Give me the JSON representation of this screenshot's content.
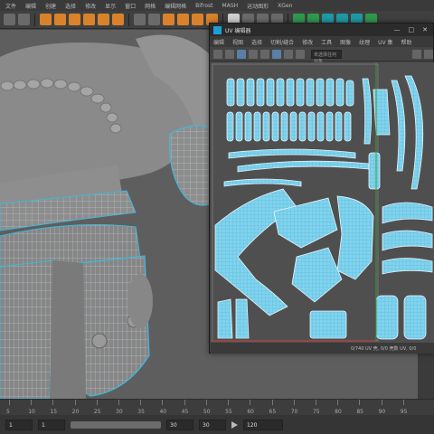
{
  "menu": [
    "文件",
    "编辑",
    "创建",
    "选择",
    "修改",
    "显示",
    "窗口",
    "网格",
    "编辑网格",
    "Bifrost",
    "MASH",
    "运动图形",
    "XGen"
  ],
  "uv_editor": {
    "title": "UV 编辑器",
    "menus": [
      "编辑",
      "视图",
      "选择",
      "切割/缝合",
      "修改",
      "工具",
      "图像",
      "纹理",
      "UV 集",
      "帮助"
    ],
    "toolbar_field_placeholder": "未选择任何对象",
    "status_text": "0/740 UV 壳, 0/0 壳数 UV, 0/0"
  },
  "timeline": {
    "ticks": [
      "5",
      "10",
      "15",
      "20",
      "25",
      "30",
      "35",
      "40",
      "45",
      "50",
      "55",
      "60",
      "65",
      "70",
      "75",
      "80",
      "85",
      "90",
      "95"
    ],
    "start_field": "1",
    "end_field": "30",
    "range_end": "30",
    "current_frame": "120"
  },
  "colors": {
    "uv_shell": "#7fd3ee",
    "uv_border": "#e6f4fa",
    "selection_wire": "#3fb8dc",
    "viewport_bg": "#5e5e5e"
  }
}
